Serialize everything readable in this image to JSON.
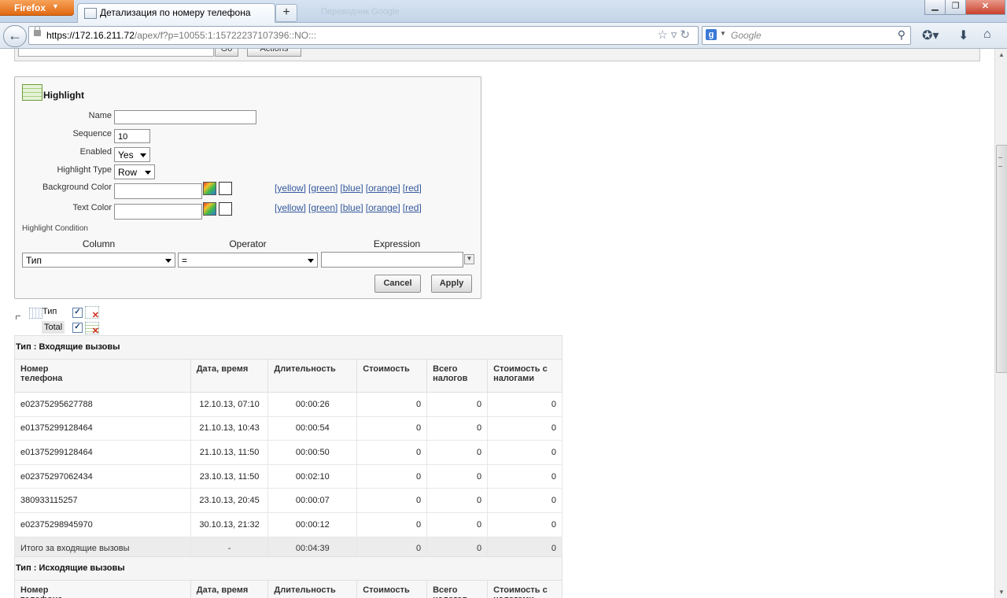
{
  "browser": {
    "menu_label": "Firefox",
    "tab_title": "Детализация по номеру телефона",
    "ghost_tab": "Переводчик Google",
    "url_host": "https://172.16.211.72",
    "url_path": "/apex/f?p=10055:1:15722237107396::NO:::",
    "search_placeholder": "Google"
  },
  "toolbar": {
    "go_label": "Go",
    "actions_label": "Actions"
  },
  "highlight": {
    "title": "Highlight",
    "name_label": "Name",
    "name_value": "",
    "sequence_label": "Sequence",
    "sequence_value": "10",
    "enabled_label": "Enabled",
    "enabled_value": "Yes",
    "type_label": "Highlight Type",
    "type_value": "Row",
    "bg_label": "Background Color",
    "text_label": "Text Color",
    "color_links": [
      "[yellow]",
      "[green]",
      "[blue]",
      "[orange]",
      "[red]"
    ],
    "condition_label": "Highlight Condition",
    "col_column": "Column",
    "col_operator": "Operator",
    "col_expression": "Expression",
    "column_value": "Тип",
    "operator_value": "=",
    "expression_value": "",
    "cancel_label": "Cancel",
    "apply_label": "Apply"
  },
  "breaks": [
    {
      "label": "Тип",
      "checked": "✓"
    },
    {
      "label": "Total",
      "checked": "✓"
    }
  ],
  "columns": [
    "Номер телефона",
    "Дата, время",
    "Длительность",
    "Стоимость",
    "Всего налогов",
    "Стоимость с налогами"
  ],
  "groups": [
    {
      "title": "Тип : Входящие вызовы",
      "rows": [
        [
          "e02375295627788",
          "12.10.13, 07:10",
          "00:00:26",
          "0",
          "0",
          "0"
        ],
        [
          "e01375299128464",
          "21.10.13, 10:43",
          "00:00:54",
          "0",
          "0",
          "0"
        ],
        [
          "e01375299128464",
          "21.10.13, 11:50",
          "00:00:50",
          "0",
          "0",
          "0"
        ],
        [
          "e02375297062434",
          "23.10.13, 11:50",
          "00:02:10",
          "0",
          "0",
          "0"
        ],
        [
          "380933115257",
          "23.10.13, 20:45",
          "00:00:07",
          "0",
          "0",
          "0"
        ],
        [
          "e02375298945970",
          "30.10.13, 21:32",
          "00:00:12",
          "0",
          "0",
          "0"
        ]
      ],
      "total": [
        "Итого за входящие вызовы",
        "-",
        "00:04:39",
        "0",
        "0",
        "0"
      ]
    },
    {
      "title": "Тип : Исходящие вызовы"
    }
  ]
}
